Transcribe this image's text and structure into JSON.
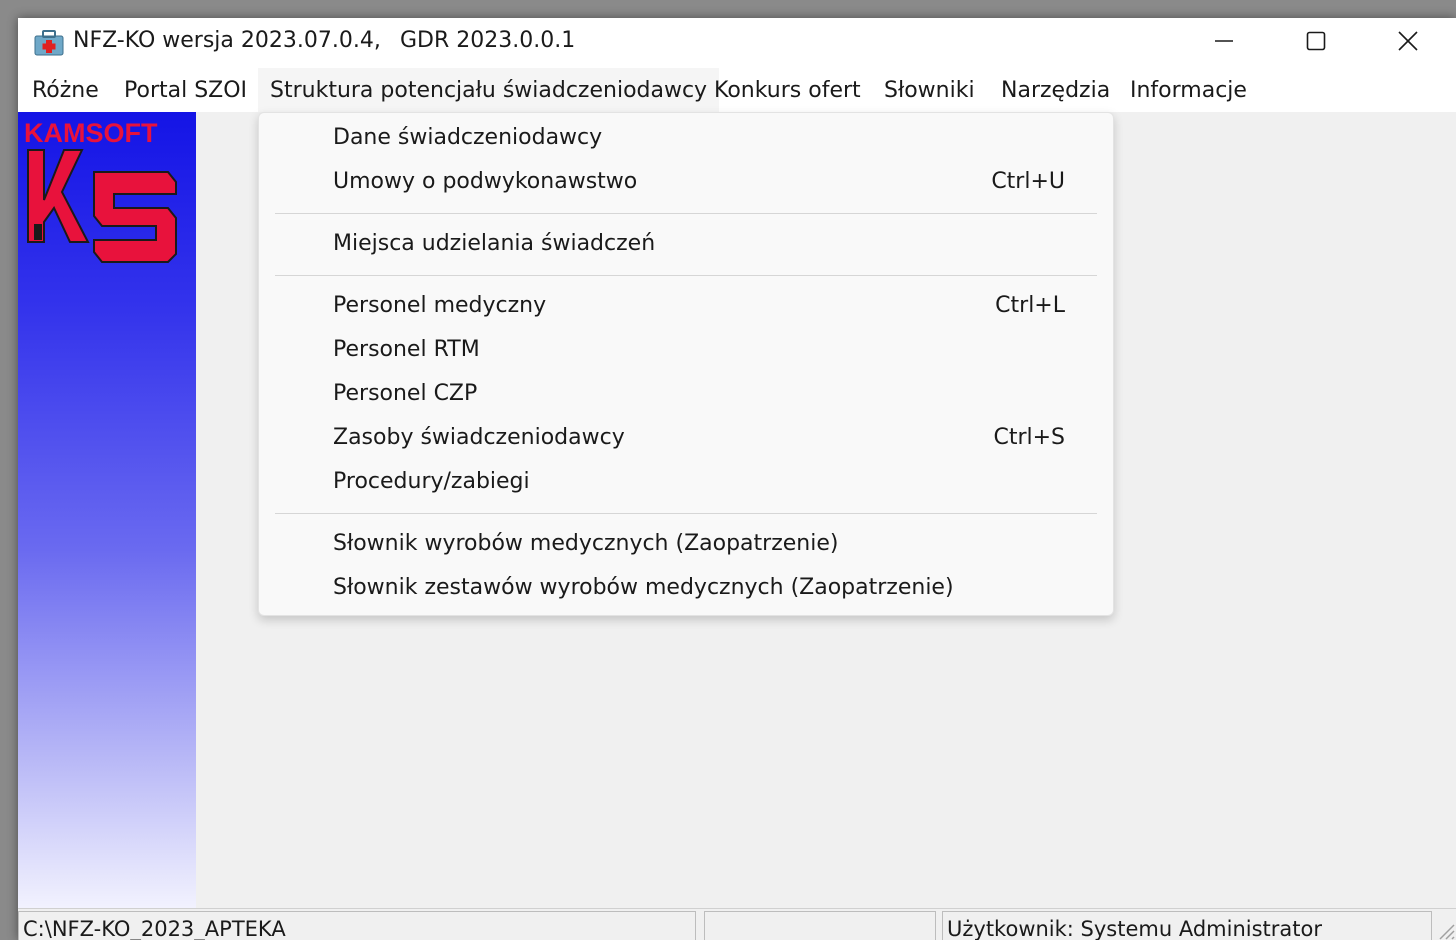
{
  "window": {
    "title": "NFZ-KO wersja 2023.07.0.4,",
    "title_gdr": "GDR 2023.0.0.1",
    "minimize_icon": "minimize-icon",
    "maximize_icon": "maximize-icon",
    "close_icon": "close-icon"
  },
  "menubar": {
    "items": [
      {
        "label": "Różne"
      },
      {
        "label": "Portal SZOI"
      },
      {
        "label": "Struktura potencjału świadczeniodawcy"
      },
      {
        "label": "Konkurs ofert"
      },
      {
        "label": "Słowniki"
      },
      {
        "label": "Narzędzia"
      },
      {
        "label": "Informacje"
      }
    ],
    "active_index": 2
  },
  "banner": {
    "brand_text": "KAMSOFT",
    "logo_icon": "ks-logo-icon",
    "brand_color": "#e8123c"
  },
  "dropdown": {
    "items": [
      {
        "label": "Dane świadczeniodawcy",
        "shortcut": ""
      },
      {
        "label": "Umowy o podwykonawstwo",
        "shortcut": "Ctrl+U"
      },
      {
        "label": "Miejsca udzielania świadczeń",
        "shortcut": ""
      },
      {
        "label": "Personel medyczny",
        "shortcut": "Ctrl+L"
      },
      {
        "label": "Personel RTM",
        "shortcut": ""
      },
      {
        "label": "Personel CZP",
        "shortcut": ""
      },
      {
        "label": "Zasoby świadczeniodawcy",
        "shortcut": "Ctrl+S"
      },
      {
        "label": "Procedury/zabiegi",
        "shortcut": ""
      },
      {
        "label": "Słownik wyrobów medycznych (Zaopatrzenie)",
        "shortcut": ""
      },
      {
        "label": "Słownik zestawów wyrobów medycznych (Zaopatrzenie)",
        "shortcut": ""
      }
    ]
  },
  "statusbar": {
    "path": "C:\\NFZ-KO_2023_APTEKA",
    "middle": "",
    "user": "Użytkownik:  Systemu Administrator"
  }
}
